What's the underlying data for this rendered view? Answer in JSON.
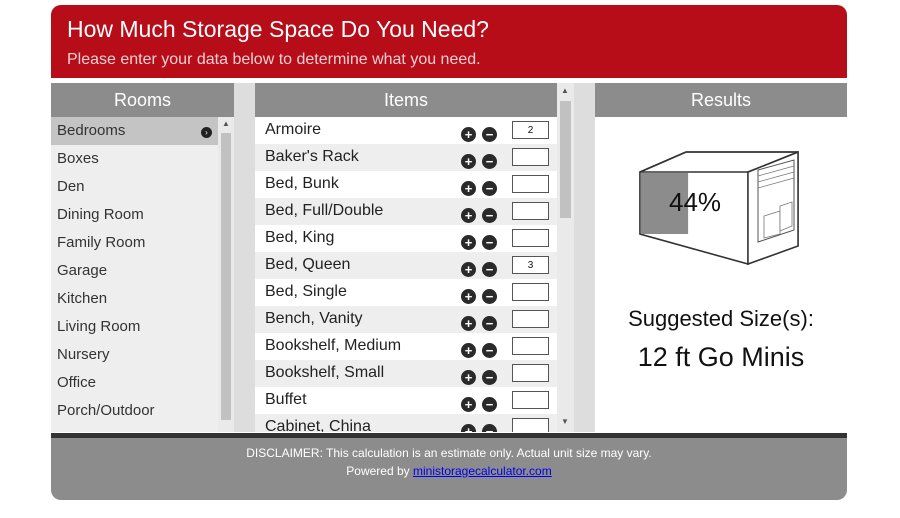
{
  "header": {
    "title": "How Much Storage Space Do You Need?",
    "subtitle": "Please enter your data below to determine what you need."
  },
  "rooms": {
    "heading": "Rooms",
    "items": [
      {
        "label": "Bedrooms",
        "active": true
      },
      {
        "label": "Boxes"
      },
      {
        "label": "Den"
      },
      {
        "label": "Dining Room"
      },
      {
        "label": "Family Room"
      },
      {
        "label": "Garage"
      },
      {
        "label": "Kitchen"
      },
      {
        "label": "Living Room"
      },
      {
        "label": "Nursery"
      },
      {
        "label": "Office"
      },
      {
        "label": "Porch/Outdoor"
      }
    ]
  },
  "items": {
    "heading": "Items",
    "rows": [
      {
        "name": "Armoire",
        "qty": "2"
      },
      {
        "name": "Baker's Rack",
        "qty": ""
      },
      {
        "name": "Bed, Bunk",
        "qty": ""
      },
      {
        "name": "Bed, Full/Double",
        "qty": ""
      },
      {
        "name": "Bed, King",
        "qty": ""
      },
      {
        "name": "Bed, Queen",
        "qty": "3"
      },
      {
        "name": "Bed, Single",
        "qty": ""
      },
      {
        "name": "Bench, Vanity",
        "qty": ""
      },
      {
        "name": "Bookshelf, Medium",
        "qty": ""
      },
      {
        "name": "Bookshelf, Small",
        "qty": ""
      },
      {
        "name": "Buffet",
        "qty": ""
      },
      {
        "name": "Cabinet, China",
        "qty": ""
      }
    ]
  },
  "results": {
    "heading": "Results",
    "percent": "44%",
    "fill_fraction": 0.44,
    "suggested_label": "Suggested Size(s):",
    "suggested_value": "12 ft Go Minis"
  },
  "footer": {
    "disclaimer": "DISCLAIMER: This calculation is an estimate only. Actual unit size may vary.",
    "powered_prefix": "Powered by",
    "powered_link": "ministoragecalculator.com"
  },
  "icons": {
    "arrow": "arrow-right-circle-icon",
    "plus": "plus-circle-icon",
    "minus": "minus-circle-icon",
    "unit": "storage-unit-icon"
  },
  "colors": {
    "brand_red": "#b60d18",
    "panel_gray": "#8c8c8c"
  }
}
